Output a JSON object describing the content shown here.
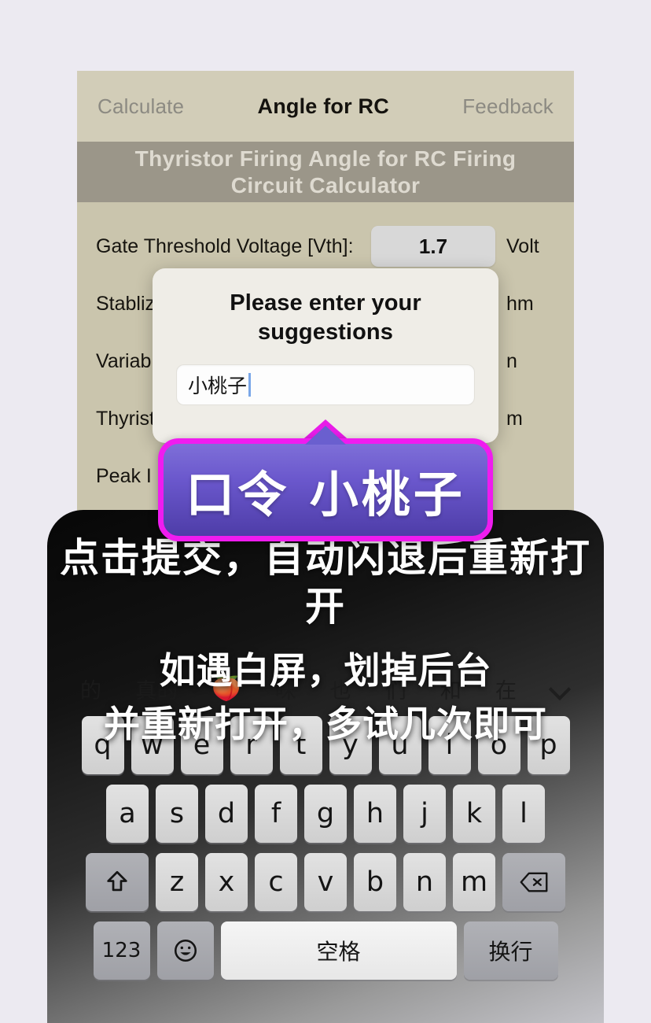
{
  "page": {
    "background_color": "#eceaf1"
  },
  "app": {
    "background_color": "#cac5ad",
    "tabs": [
      {
        "label": "Calculate",
        "active": false
      },
      {
        "label": "Angle for RC",
        "active": true
      },
      {
        "label": "Feedback",
        "active": false
      }
    ],
    "title_line1": "Thyristor Firing Angle for RC Firing",
    "title_line2": "Circuit Calculator",
    "title_band_color": "#9b9689",
    "form_rows": [
      {
        "label": "Gate Threshold Voltage [Vth]:",
        "value": "1.7",
        "unit": "Volt"
      },
      {
        "label": "Stabliz",
        "value": "",
        "unit": "hm"
      },
      {
        "label": "Variabl",
        "value": "",
        "unit": "n"
      },
      {
        "label": "Thyrist",
        "value": "",
        "unit": "m"
      },
      {
        "label": "Peak I",
        "value": "",
        "unit": ""
      }
    ]
  },
  "modal": {
    "title": "Please enter your suggestions",
    "input_value": "小桃子",
    "input_placeholder": ""
  },
  "callout": {
    "text": "口令 小桃子",
    "border_color": "#ef1cef",
    "fill_top_color": "#7e6fd8",
    "fill_bottom_color": "#4e3da8"
  },
  "instructions": {
    "line1": "点击提交，自动闪退后重新打开",
    "line2": "如遇白屏，划掉后台",
    "line3": "并重新打开，多试几次即可"
  },
  "keyboard": {
    "suggestions": [
      "的",
      "真的",
      "🍑",
      "味",
      "也",
      "们",
      "和",
      "在"
    ],
    "collapse_icon": "chevron-down-icon",
    "row1": [
      "q",
      "w",
      "e",
      "r",
      "t",
      "y",
      "u",
      "i",
      "o",
      "p"
    ],
    "row2": [
      "a",
      "s",
      "d",
      "f",
      "g",
      "h",
      "j",
      "k",
      "l"
    ],
    "row3": [
      "z",
      "x",
      "c",
      "v",
      "b",
      "n",
      "m"
    ],
    "shift_icon": "shift-arrow-icon",
    "backspace_icon": "backspace-icon",
    "numbers_key": "123",
    "emoji_key": "emoji-smiley-icon",
    "space_key": "空格",
    "return_key": "换行"
  }
}
